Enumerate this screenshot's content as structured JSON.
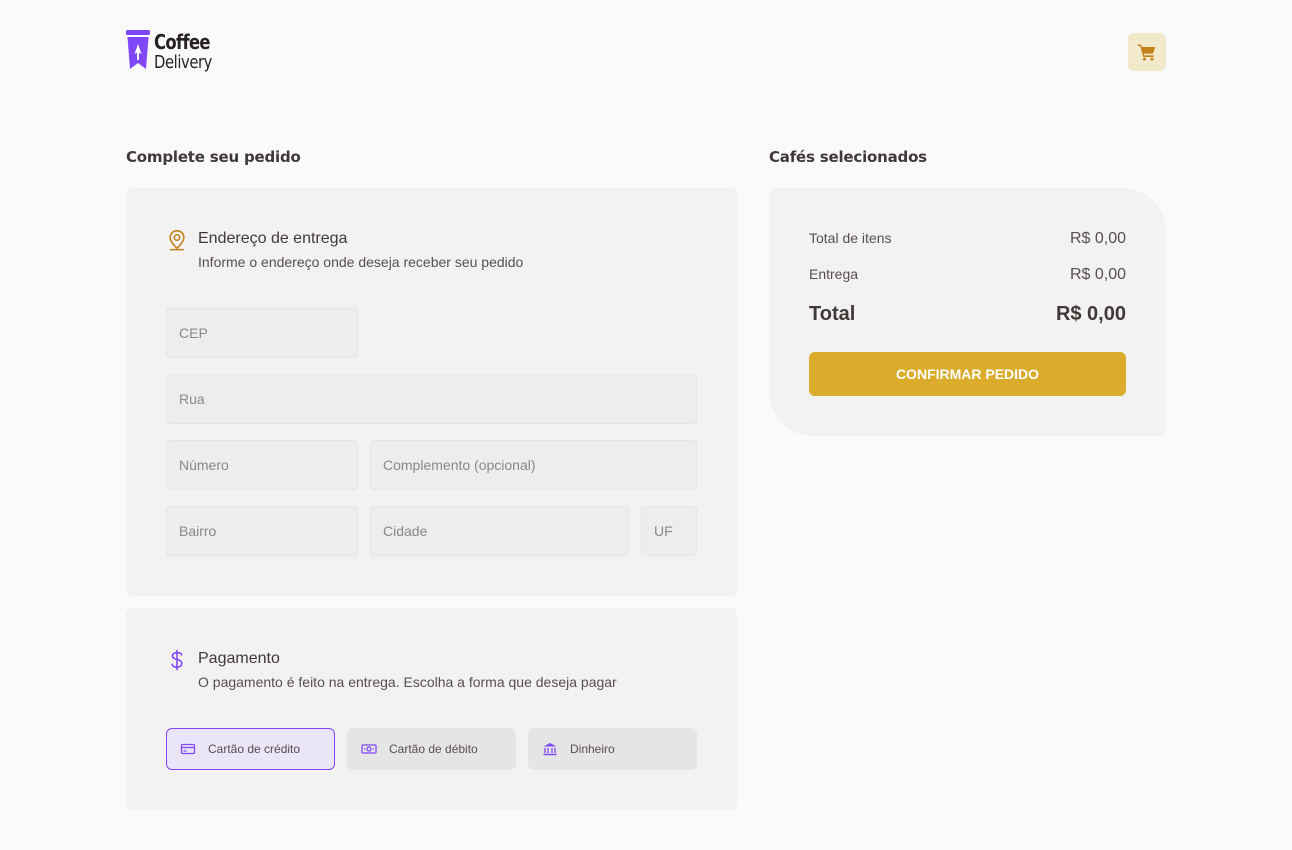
{
  "brand": {
    "line1": "Coffee",
    "line2": "Delivery"
  },
  "header": {
    "cart_icon": "cart-icon"
  },
  "checkout": {
    "title": "Complete seu pedido",
    "address": {
      "icon": "map-pin-icon",
      "title": "Endereço de entrega",
      "subtitle": "Informe o endereço onde deseja receber seu pedido",
      "fields": {
        "cep": "CEP",
        "rua": "Rua",
        "numero": "Número",
        "complemento": "Complemento (opcional)",
        "bairro": "Bairro",
        "cidade": "Cidade",
        "uf": "UF"
      }
    },
    "payment": {
      "icon": "dollar-icon",
      "title": "Pagamento",
      "subtitle": "O pagamento é feito na entrega. Escolha a forma que deseja pagar",
      "options": [
        {
          "label": "Cartão de crédito",
          "icon": "credit-card-icon",
          "selected": true
        },
        {
          "label": "Cartão de débito",
          "icon": "money-icon",
          "selected": false
        },
        {
          "label": "Dinheiro",
          "icon": "bank-icon",
          "selected": false
        }
      ]
    }
  },
  "summary": {
    "title": "Cafés selecionados",
    "items_label": "Total de itens",
    "items_value": "R$ 0,00",
    "delivery_label": "Entrega",
    "delivery_value": "R$ 0,00",
    "total_label": "Total",
    "total_value": "R$ 0,00",
    "confirm_label": "CONFIRMAR PEDIDO"
  },
  "colors": {
    "background": "#fafafa",
    "card": "#f3f2f2",
    "input": "#ededed",
    "brand_purple": "#8047f8",
    "yellow": "#dbac2c",
    "yellow_dark": "#c47f17",
    "yellow_light": "#f1e9c9",
    "text_title": "#403937"
  }
}
